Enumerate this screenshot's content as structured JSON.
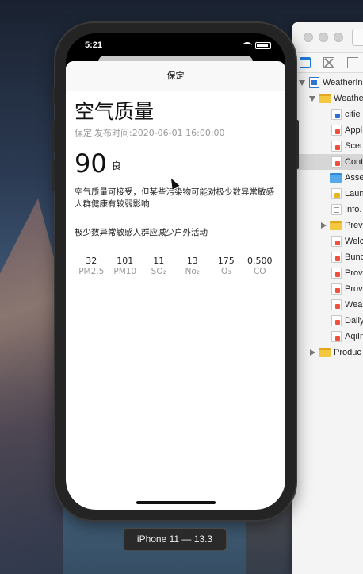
{
  "status_bar": {
    "time": "5:21"
  },
  "nav": {
    "title": "保定"
  },
  "air_quality": {
    "title": "空气质量",
    "city": "保定",
    "publish_time": "发布时间:2020-06-01 16:00:00",
    "aqi": "90",
    "level": "良",
    "health_effect": "空气质量可接受，但某些污染物可能对极少数异常敏感人群健康有较弱影响",
    "measure": "极少数异常敏感人群应减少户外活动",
    "pollutants": [
      {
        "value": "32",
        "name": "PM2.5"
      },
      {
        "value": "101",
        "name": "PM10"
      },
      {
        "value": "11",
        "name": "SO₂"
      },
      {
        "value": "13",
        "name": "No₂"
      },
      {
        "value": "175",
        "name": "O₃"
      },
      {
        "value": "0.500",
        "name": "CO"
      }
    ]
  },
  "simulator": {
    "device_label": "iPhone 11 — 13.3"
  },
  "xcode": {
    "files": [
      {
        "label": "WeatherIn",
        "icon": "project-icon"
      },
      {
        "label": "Weather",
        "icon": "folder-icon"
      },
      {
        "label": "citie",
        "icon": "json-file-icon"
      },
      {
        "label": "Appl",
        "icon": "swift-file-icon"
      },
      {
        "label": "Scen",
        "icon": "swift-file-icon"
      },
      {
        "label": "Cont",
        "icon": "swift-file-icon"
      },
      {
        "label": "Asse",
        "icon": "asset-folder-icon"
      },
      {
        "label": "Laun",
        "icon": "storyboard-icon"
      },
      {
        "label": "Info.",
        "icon": "plist-icon"
      },
      {
        "label": "Prev",
        "icon": "folder-icon"
      },
      {
        "label": "Welc",
        "icon": "swift-file-icon"
      },
      {
        "label": "Bund",
        "icon": "swift-file-icon"
      },
      {
        "label": "Prov",
        "icon": "swift-file-icon"
      },
      {
        "label": "Prov",
        "icon": "swift-file-icon"
      },
      {
        "label": "Wea",
        "icon": "swift-file-icon"
      },
      {
        "label": "Daily",
        "icon": "swift-file-icon"
      },
      {
        "label": "AqiIn",
        "icon": "swift-file-icon"
      },
      {
        "label": "Produc",
        "icon": "folder-icon"
      }
    ]
  }
}
